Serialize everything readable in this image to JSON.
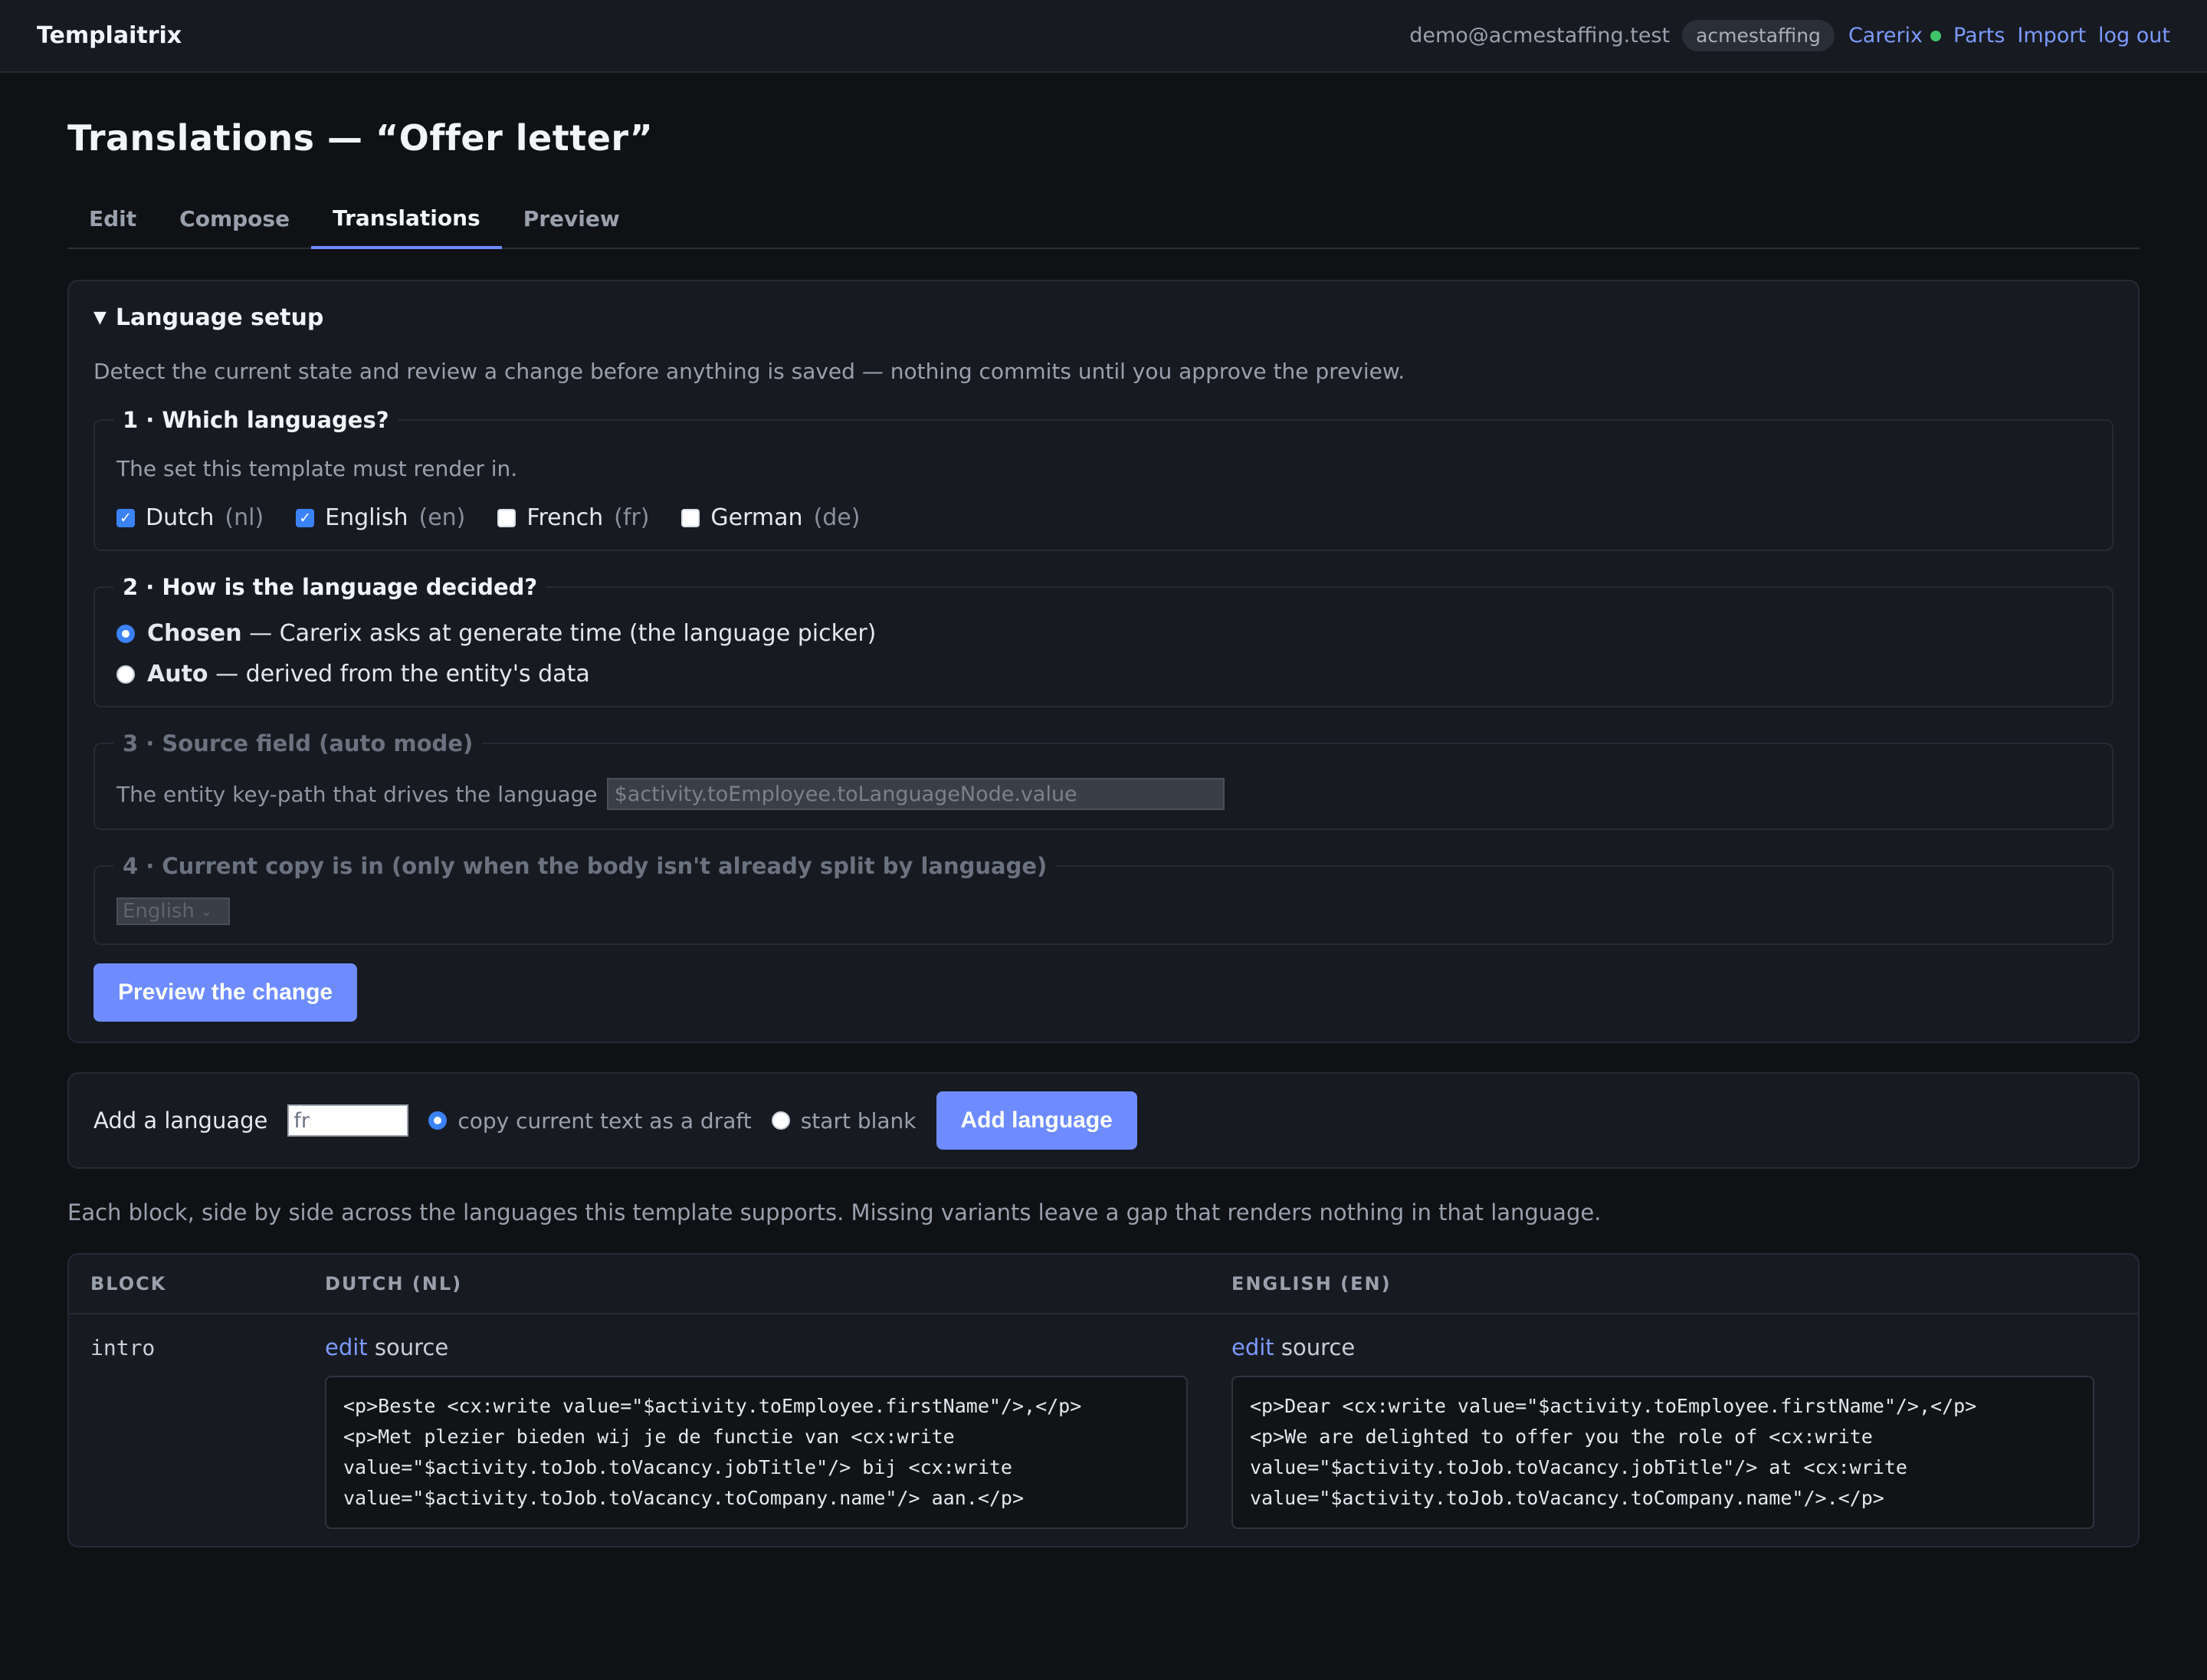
{
  "app": {
    "brand": "Templaitrix",
    "user_email": "demo@acmestaffing.test",
    "tenant": "acmestaffing",
    "connection": "Carerix",
    "connection_status_color": "#3fc46a",
    "nav": [
      "Parts",
      "Import",
      "log out"
    ]
  },
  "page": {
    "title": "Translations — “Offer letter”",
    "tabs": [
      "Edit",
      "Compose",
      "Translations",
      "Preview"
    ],
    "active_tab": "Translations"
  },
  "setup": {
    "summary": "Language setup",
    "hint": "Detect the current state and review a change before anything is saved — nothing commits until you approve the preview.",
    "step1": {
      "legend": "1 · Which languages?",
      "hint": "The set this template must render in.",
      "languages": [
        {
          "name": "Dutch",
          "code": "(nl)",
          "checked": true
        },
        {
          "name": "English",
          "code": "(en)",
          "checked": true
        },
        {
          "name": "French",
          "code": "(fr)",
          "checked": false
        },
        {
          "name": "German",
          "code": "(de)",
          "checked": false
        }
      ]
    },
    "step2": {
      "legend": "2 · How is the language decided?",
      "options": [
        {
          "label": "Chosen",
          "desc": " — Carerix asks at generate time (the language picker)",
          "checked": true
        },
        {
          "label": "Auto",
          "desc": " — derived from the entity's data",
          "checked": false
        }
      ]
    },
    "step3": {
      "legend": "3 · Source field",
      "legend_muted": " (auto mode)",
      "hint": "The entity key-path that drives the language",
      "value": "$activity.toEmployee.toLanguageNode.value"
    },
    "step4": {
      "legend": "4 · Current copy is in",
      "legend_muted": " (only when the body isn't already split by language)",
      "selected": "English"
    },
    "preview_button": "Preview the change"
  },
  "add_language": {
    "label": "Add a language",
    "input_value": "fr",
    "option_copy": "copy current text as a draft",
    "option_blank": "start blank",
    "selected_option": "copy",
    "button": "Add language"
  },
  "blocks": {
    "hint": "Each block, side by side across the languages this template supports. Missing variants leave a gap that renders nothing in that language.",
    "headers": [
      "BLOCK",
      "DUTCH (NL)",
      "ENGLISH (EN)"
    ],
    "edit_link": "edit",
    "edit_suffix": " source",
    "rows": [
      {
        "name": "intro",
        "nl": "<p>Beste <cx:write value=\"$activity.toEmployee.firstName\"/>,</p>\n<p>Met plezier bieden wij je de functie van <cx:write\nvalue=\"$activity.toJob.toVacancy.jobTitle\"/> bij <cx:write\nvalue=\"$activity.toJob.toVacancy.toCompany.name\"/> aan.</p>",
        "en": "<p>Dear <cx:write value=\"$activity.toEmployee.firstName\"/>,</p>\n<p>We are delighted to offer you the role of <cx:write\nvalue=\"$activity.toJob.toVacancy.jobTitle\"/> at <cx:write\nvalue=\"$activity.toJob.toVacancy.toCompany.name\"/>.</p>"
      }
    ]
  }
}
